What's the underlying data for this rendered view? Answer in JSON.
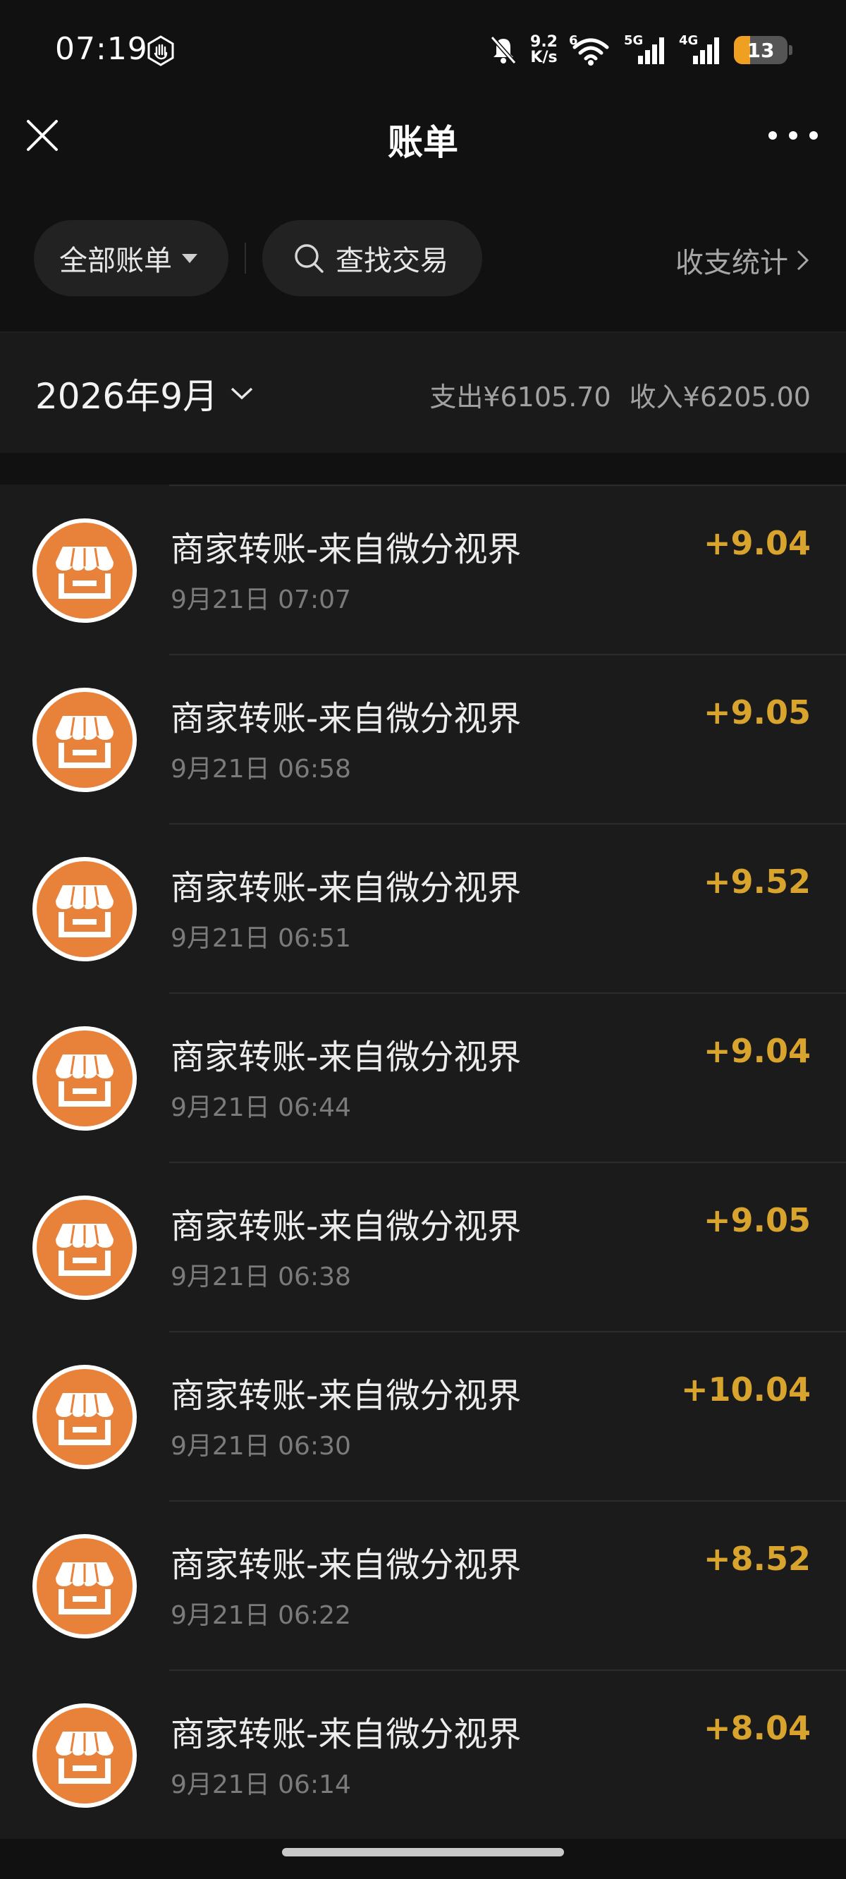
{
  "status": {
    "time": "07:19",
    "net_speed_value": "9.2",
    "net_speed_unit": "K/s",
    "wifi_badge": "6",
    "sim1_label": "5G",
    "sim2_label": "4G",
    "battery_level": "13",
    "battery_fraction": 0.3
  },
  "header": {
    "title": "账单"
  },
  "filters": {
    "all_bills_label": "全部账单",
    "search_label": "查找交易",
    "stats_label": "收支统计"
  },
  "month": {
    "label": "2026年9月",
    "expense_label": "支出",
    "expense_value": "¥6105.70",
    "income_label": "收入",
    "income_value": "¥6205.00"
  },
  "transactions": [
    {
      "title": "商家转账-来自微分视界",
      "time": "9月21日 07:07",
      "amount": "+9.04"
    },
    {
      "title": "商家转账-来自微分视界",
      "time": "9月21日 06:58",
      "amount": "+9.05"
    },
    {
      "title": "商家转账-来自微分视界",
      "time": "9月21日 06:51",
      "amount": "+9.52"
    },
    {
      "title": "商家转账-来自微分视界",
      "time": "9月21日 06:44",
      "amount": "+9.04"
    },
    {
      "title": "商家转账-来自微分视界",
      "time": "9月21日 06:38",
      "amount": "+9.05"
    },
    {
      "title": "商家转账-来自微分视界",
      "time": "9月21日 06:30",
      "amount": "+10.04"
    },
    {
      "title": "商家转账-来自微分视界",
      "time": "9月21日 06:22",
      "amount": "+8.52"
    },
    {
      "title": "商家转账-来自微分视界",
      "time": "9月21日 06:14",
      "amount": "+8.04"
    }
  ],
  "colors": {
    "accent_amount": "#d8a42e",
    "avatar_bg": "#e8823a",
    "battery": "#f0a020"
  },
  "icons": {
    "avatar": "storefront-icon",
    "close": "close-icon",
    "more": "more-icon",
    "search": "search-icon",
    "chevron": "chevron-right-icon"
  }
}
